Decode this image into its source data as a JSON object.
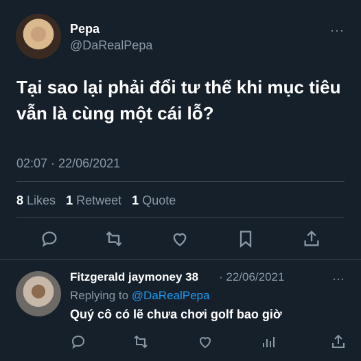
{
  "tweet": {
    "display_name": "Pepa",
    "handle": "@DaRealPepa",
    "more": "···",
    "text": "Tại sao lại phải đổi tư thế khi mục tiêu vẫn là cùng một cái lỗ?",
    "timestamp": "02:07 · 22/06/2021",
    "stats": {
      "likes_count": "8",
      "likes_label": "Likes",
      "retweets_count": "1",
      "retweets_label": "Retweet",
      "quotes_count": "1",
      "quotes_label": "Quote"
    },
    "action_icons": [
      "reply-icon",
      "retweet-icon",
      "like-icon",
      "bookmark-icon",
      "share-icon"
    ]
  },
  "reply": {
    "display_name": "Fitzgerald jaymoney 38",
    "date": "· 22/06/2021",
    "more": "···",
    "replying_prefix": "Replying to",
    "replying_handle": "@DaRealPepa",
    "text": "Quý cô có lẽ chưa chơi golf bao giờ",
    "action_icons": [
      "reply-icon",
      "retweet-icon",
      "like-icon",
      "analytics-icon",
      "share-icon"
    ]
  },
  "colors": {
    "background": "#15202b",
    "text": "#ffffff",
    "muted": "#8b98a5",
    "link": "#1d9bf0",
    "divider": "#38444d"
  }
}
